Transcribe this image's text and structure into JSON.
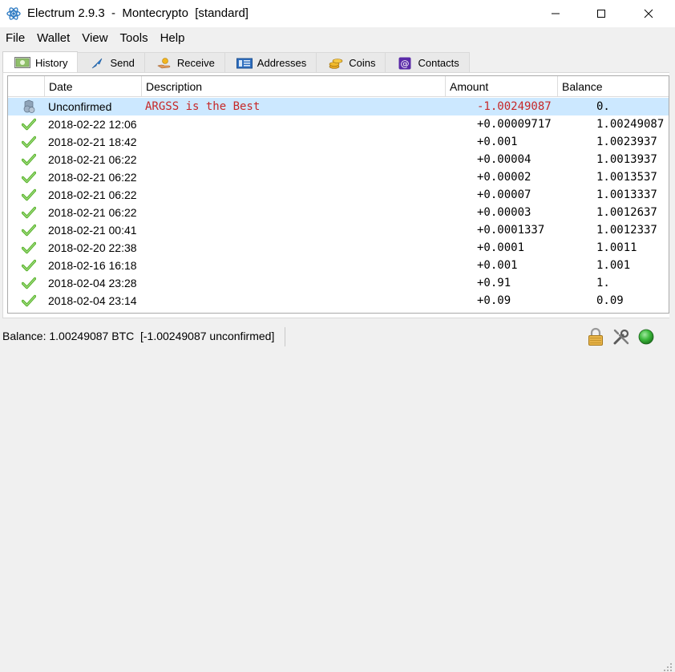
{
  "window": {
    "title": "Electrum 2.9.3  -  Montecrypto  [standard]",
    "controls": {
      "minimize": "—",
      "maximize": "☐",
      "close": "✕"
    }
  },
  "menu": [
    "File",
    "Wallet",
    "View",
    "Tools",
    "Help"
  ],
  "tabs": [
    {
      "label": "History",
      "icon": "history-icon",
      "active": true
    },
    {
      "label": "Send",
      "icon": "send-icon",
      "active": false
    },
    {
      "label": "Receive",
      "icon": "receive-icon",
      "active": false
    },
    {
      "label": "Addresses",
      "icon": "addresses-icon",
      "active": false
    },
    {
      "label": "Coins",
      "icon": "coins-icon",
      "active": false
    },
    {
      "label": "Contacts",
      "icon": "contacts-icon",
      "active": false
    }
  ],
  "history": {
    "columns": {
      "status": "",
      "date": "Date",
      "description": "Description",
      "amount": "Amount",
      "balance": "Balance"
    },
    "rows": [
      {
        "status": "unconfirmed",
        "date": "Unconfirmed",
        "description": "ARGSS is the Best",
        "amount": "-1.00249087",
        "balance": "0."
      },
      {
        "status": "confirmed",
        "date": "2018-02-22 12:06",
        "description": "",
        "amount": "+0.00009717",
        "balance": "1.00249087"
      },
      {
        "status": "confirmed",
        "date": "2018-02-21 18:42",
        "description": "",
        "amount": "+0.001",
        "balance": "1.0023937"
      },
      {
        "status": "confirmed",
        "date": "2018-02-21 06:22",
        "description": "",
        "amount": "+0.00004",
        "balance": "1.0013937"
      },
      {
        "status": "confirmed",
        "date": "2018-02-21 06:22",
        "description": "",
        "amount": "+0.00002",
        "balance": "1.0013537"
      },
      {
        "status": "confirmed",
        "date": "2018-02-21 06:22",
        "description": "",
        "amount": "+0.00007",
        "balance": "1.0013337"
      },
      {
        "status": "confirmed",
        "date": "2018-02-21 06:22",
        "description": "",
        "amount": "+0.00003",
        "balance": "1.0012637"
      },
      {
        "status": "confirmed",
        "date": "2018-02-21 00:41",
        "description": "",
        "amount": "+0.0001337",
        "balance": "1.0012337"
      },
      {
        "status": "confirmed",
        "date": "2018-02-20 22:38",
        "description": "",
        "amount": "+0.0001",
        "balance": "1.0011"
      },
      {
        "status": "confirmed",
        "date": "2018-02-16 16:18",
        "description": "",
        "amount": "+0.001",
        "balance": "1.001"
      },
      {
        "status": "confirmed",
        "date": "2018-02-04 23:28",
        "description": "",
        "amount": "+0.91",
        "balance": "1."
      },
      {
        "status": "confirmed",
        "date": "2018-02-04 23:14",
        "description": "",
        "amount": "+0.09",
        "balance": "0.09"
      }
    ]
  },
  "statusbar": {
    "text": "Balance: 1.00249087 BTC  [-1.00249087 unconfirmed]",
    "icons": [
      "lock-icon",
      "preferences-icon",
      "network-status-icon"
    ]
  },
  "colors": {
    "selected_row": "#cce8ff",
    "negative": "#c62828",
    "confirmed_check": "#5cb530",
    "network_online": "#3cb93c"
  }
}
